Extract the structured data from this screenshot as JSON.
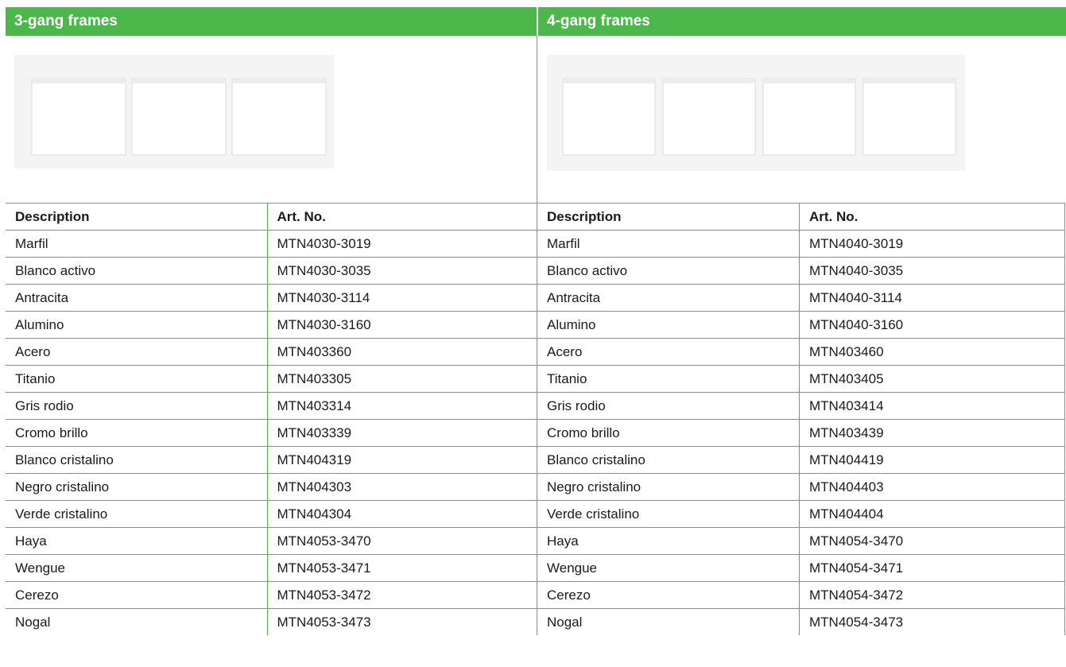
{
  "left": {
    "title": "3-gang frames",
    "headers": [
      "Description",
      "Art. No."
    ],
    "rows": [
      [
        "Marfil",
        "MTN4030-3019"
      ],
      [
        "Blanco activo",
        "MTN4030-3035"
      ],
      [
        "Antracita",
        "MTN4030-3114"
      ],
      [
        "Alumino",
        "MTN4030-3160"
      ],
      [
        "Acero",
        "MTN403360"
      ],
      [
        "Titanio",
        "MTN403305"
      ],
      [
        "Gris rodio",
        "MTN403314"
      ],
      [
        "Cromo brillo",
        "MTN403339"
      ],
      [
        "Blanco cristalino",
        "MTN404319"
      ],
      [
        "Negro cristalino",
        "MTN404303"
      ],
      [
        "Verde cristalino",
        "MTN404304"
      ],
      [
        "Haya",
        "MTN4053-3470"
      ],
      [
        "Wengue",
        "MTN4053-3471"
      ],
      [
        "Cerezo",
        "MTN4053-3472"
      ],
      [
        "Nogal",
        "MTN4053-3473"
      ]
    ]
  },
  "right": {
    "title": "4-gang frames",
    "headers": [
      "Description",
      "Art. No."
    ],
    "rows": [
      [
        "Marfil",
        "MTN4040-3019"
      ],
      [
        "Blanco activo",
        "MTN4040-3035"
      ],
      [
        "Antracita",
        "MTN4040-3114"
      ],
      [
        "Alumino",
        "MTN4040-3160"
      ],
      [
        "Acero",
        "MTN403460"
      ],
      [
        "Titanio",
        "MTN403405"
      ],
      [
        "Gris rodio",
        "MTN403414"
      ],
      [
        "Cromo brillo",
        "MTN403439"
      ],
      [
        "Blanco cristalino",
        "MTN404419"
      ],
      [
        "Negro cristalino",
        "MTN404403"
      ],
      [
        "Verde cristalino",
        "MTN404404"
      ],
      [
        "Haya",
        "MTN4054-3470"
      ],
      [
        "Wengue",
        "MTN4054-3471"
      ],
      [
        "Cerezo",
        "MTN4054-3472"
      ],
      [
        "Nogal",
        "MTN4054-3473"
      ]
    ]
  },
  "colors": {
    "accent": "#4cb74a",
    "text": "#1a1a1a",
    "frame": "#f4f4f4"
  }
}
